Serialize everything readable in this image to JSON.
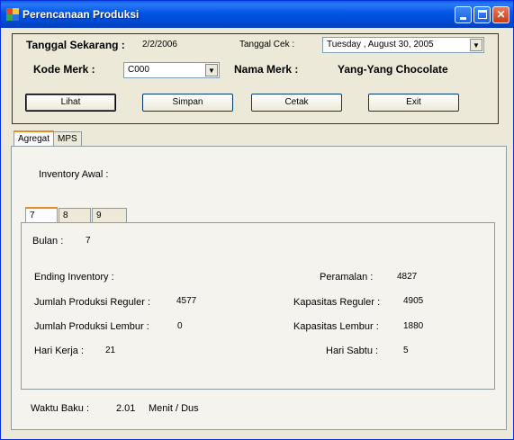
{
  "window": {
    "title": "Perencanaan Produksi"
  },
  "header": {
    "tanggal_sekarang_label": "Tanggal Sekarang :",
    "tanggal_sekarang_value": "2/2/2006",
    "tanggal_cek_label": "Tanggal Cek :",
    "tanggal_cek_value": "Tuesday ,    August   30, 2005",
    "kode_merk_label": "Kode Merk :",
    "kode_merk_value": "C000",
    "nama_merk_label": "Nama Merk :",
    "nama_merk_value": "Yang-Yang Chocolate"
  },
  "buttons": {
    "lihat": "Lihat",
    "simpan": "Simpan",
    "cetak": "Cetak",
    "exit": "Exit"
  },
  "tabs": {
    "agregat": "Agregat",
    "mps": "MPS"
  },
  "agregat": {
    "inventory_awal_label": "Inventory Awal :"
  },
  "month_tabs": [
    "7",
    "8",
    "9"
  ],
  "detail": {
    "bulan_label": "Bulan :",
    "bulan_value": "7",
    "ending_inventory_label": "Ending Inventory :",
    "peramalan_label": "Peramalan :",
    "peramalan_value": "4827",
    "jumlah_reguler_label": "Jumlah Produksi Reguler :",
    "jumlah_reguler_value": "4577",
    "kapasitas_reguler_label": "Kapasitas Reguler :",
    "kapasitas_reguler_value": "4905",
    "jumlah_lembur_label": "Jumlah Produksi Lembur :",
    "jumlah_lembur_value": "0",
    "kapasitas_lembur_label": "Kapasitas Lembur :",
    "kapasitas_lembur_value": "1880",
    "hari_kerja_label": "Hari Kerja :",
    "hari_kerja_value": "21",
    "hari_sabtu_label": "Hari Sabtu :",
    "hari_sabtu_value": "5"
  },
  "footer": {
    "waktu_baku_label": "Waktu Baku :",
    "waktu_baku_value": "2.01",
    "waktu_baku_unit": "Menit / Dus"
  }
}
